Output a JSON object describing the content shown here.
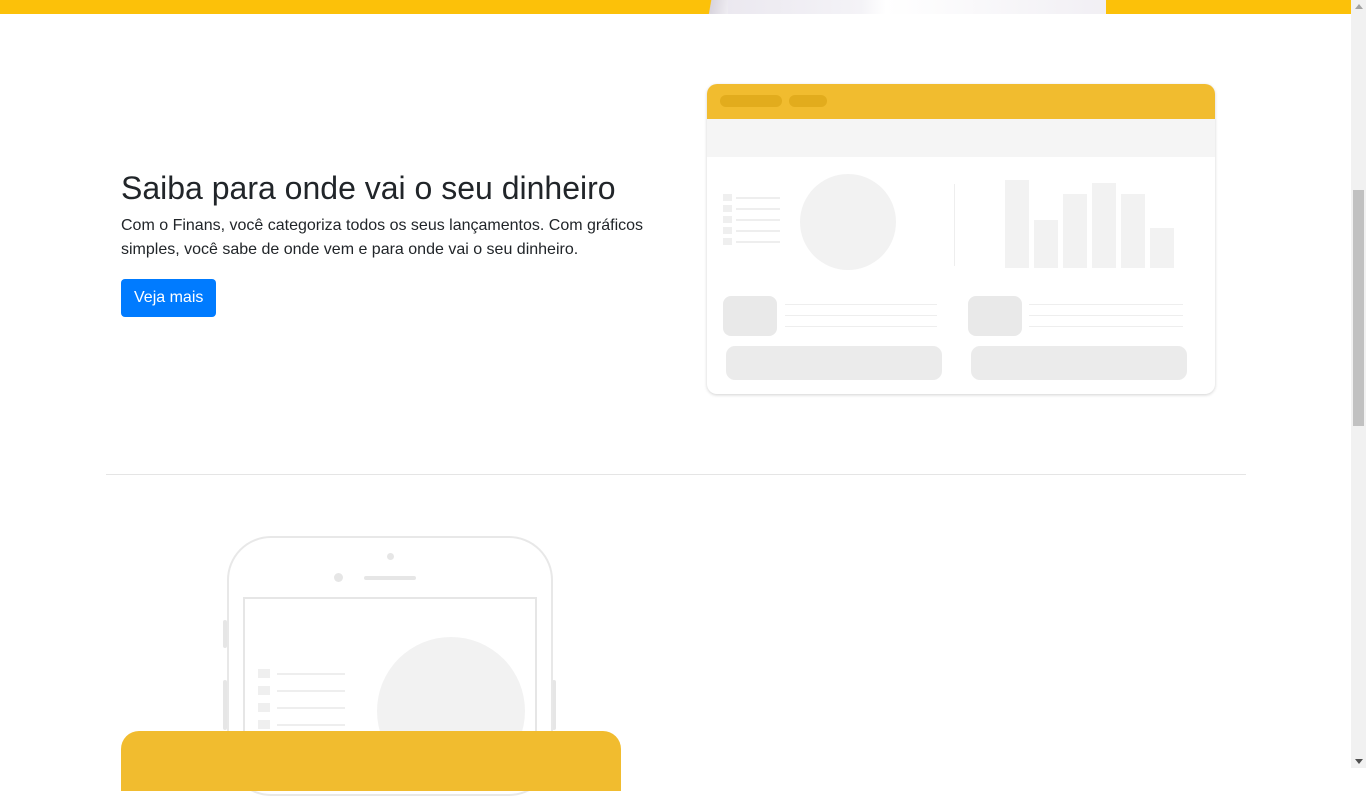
{
  "feature": {
    "title": "Saiba para onde vai o seu dinheiro",
    "description": "Com o Finans, você categoriza todos os seus lançamentos. Com gráficos simples, você sabe de onde vem e para onde vai o seu dinheiro.",
    "cta_label": "Veja mais"
  },
  "colors": {
    "brand_yellow": "#fcc109",
    "card_yellow": "#f1bc2f",
    "primary_button": "#007bff"
  },
  "illustrations": {
    "dashboard": "dashboard-mockup-illustration",
    "phone": "phone-mockup-illustration"
  }
}
